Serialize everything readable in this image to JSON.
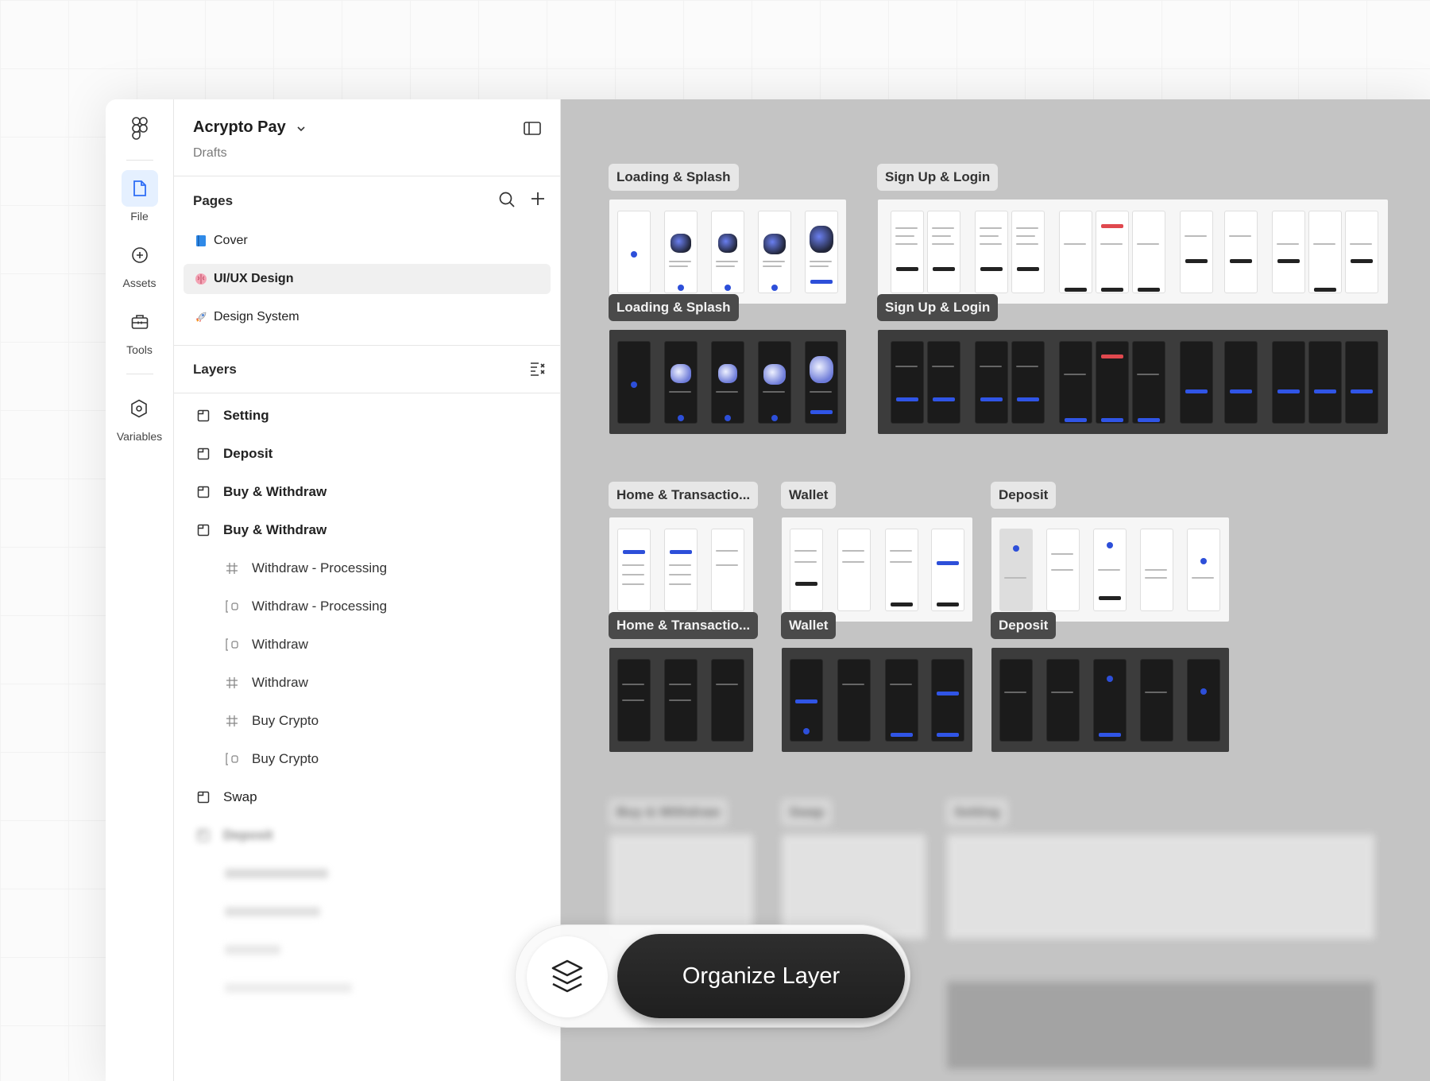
{
  "project": {
    "title": "Acrypto Pay",
    "subtitle": "Drafts"
  },
  "rail": {
    "items": [
      {
        "label": "File",
        "icon": "file-icon"
      },
      {
        "label": "Assets",
        "icon": "assets-icon"
      },
      {
        "label": "Tools",
        "icon": "toolbox-icon"
      },
      {
        "label": "Variables",
        "icon": "variables-icon"
      }
    ]
  },
  "pages": {
    "heading": "Pages",
    "items": [
      {
        "label": "Cover",
        "icon": "blue-book-icon"
      },
      {
        "label": "UI/UX Design",
        "icon": "brain-icon",
        "selected": true
      },
      {
        "label": "Design System",
        "icon": "rocket-icon"
      }
    ]
  },
  "layers": {
    "heading": "Layers",
    "items": [
      {
        "label": "Setting",
        "type": "section"
      },
      {
        "label": "Deposit",
        "type": "section"
      },
      {
        "label": "Buy & Withdraw",
        "type": "section"
      },
      {
        "label": "Buy & Withdraw",
        "type": "section"
      },
      {
        "label": "Withdraw - Processing",
        "type": "frame"
      },
      {
        "label": "Withdraw - Processing",
        "type": "component"
      },
      {
        "label": "Withdraw",
        "type": "component"
      },
      {
        "label": "Withdraw",
        "type": "frame"
      },
      {
        "label": "Buy Crypto",
        "type": "frame"
      },
      {
        "label": "Buy Crypto",
        "type": "component"
      },
      {
        "label": "Swap",
        "type": "section"
      },
      {
        "label": "Deposit",
        "type": "section",
        "blurred": true
      }
    ]
  },
  "canvas": {
    "light_labels": [
      "Loading & Splash",
      "Sign Up & Login",
      "Home & Transactio...",
      "Wallet",
      "Deposit"
    ],
    "dark_labels": [
      "Loading & Splash",
      "Sign Up & Login",
      "Home & Transactio...",
      "Wallet",
      "Deposit"
    ],
    "faded_labels": [
      "Buy & Withdraw",
      "Swap",
      "Setting"
    ]
  },
  "action": {
    "button_label": "Organize Layer",
    "icon": "layers-stack-icon"
  },
  "colors": {
    "accent": "#2d4fd9",
    "canvas": "#c4c4c4",
    "button": "#262626"
  }
}
